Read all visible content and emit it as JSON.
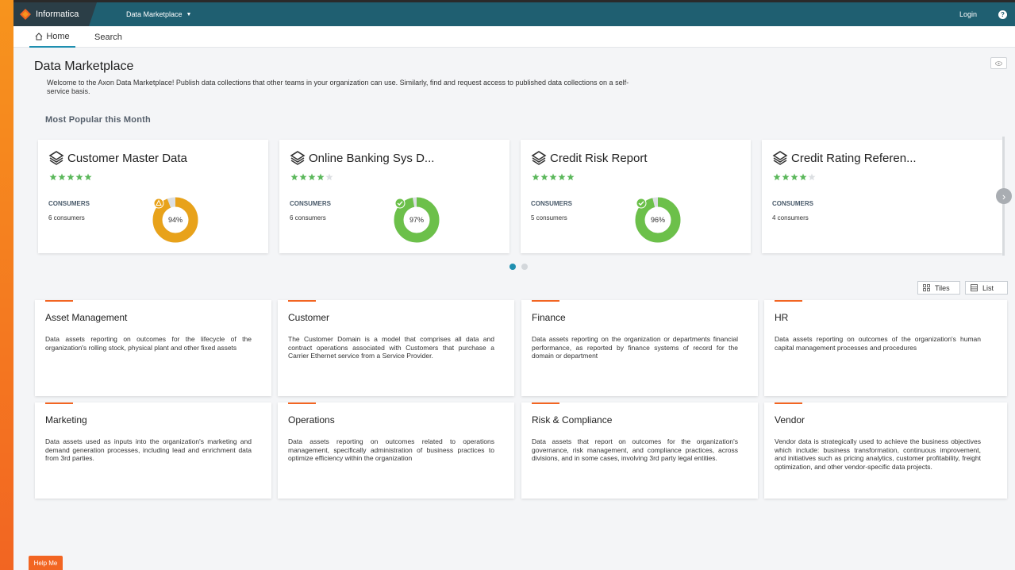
{
  "topbar": {
    "brand": "Informatica",
    "app_menu": "Data Marketplace",
    "login": "Login",
    "help": "?"
  },
  "nav": {
    "home": "Home",
    "search": "Search"
  },
  "page": {
    "title": "Data Marketplace",
    "welcome": "Welcome to the Axon Data Marketplace! Publish data collections that other teams in your organization can use. Similarly, find and request access to published data collections on a self-service basis.",
    "section_title": "Most Popular this Month"
  },
  "popular": [
    {
      "title": "Customer Master Data",
      "rating": 5,
      "consumers_label": "CONSUMERS",
      "consumers": "6 consumers",
      "percent": 94,
      "percent_label": "94%",
      "status": "warning",
      "color": "#e8a21a"
    },
    {
      "title": "Online Banking Sys D...",
      "rating": 4,
      "consumers_label": "CONSUMERS",
      "consumers": "6 consumers",
      "percent": 97,
      "percent_label": "97%",
      "status": "ok",
      "color": "#6cc04a"
    },
    {
      "title": "Credit Risk Report",
      "rating": 5,
      "consumers_label": "CONSUMERS",
      "consumers": "5 consumers",
      "percent": 96,
      "percent_label": "96%",
      "status": "ok",
      "color": "#6cc04a"
    },
    {
      "title": "Credit Rating Referen...",
      "rating": 4,
      "consumers_label": "CONSUMERS",
      "consumers": "4 consumers"
    }
  ],
  "carousel": {
    "pages": 2,
    "active": 0
  },
  "view_toggle": {
    "tiles": "Tiles",
    "list": "List"
  },
  "domains": [
    {
      "title": "Asset Management",
      "desc": "Data assets reporting on outcomes for the lifecycle of the organization's rolling stock, physical plant and other fixed assets"
    },
    {
      "title": "Customer",
      "desc": "The Customer Domain is a model that comprises all data and contract operations associated with Customers that purchase a Carrier Ethernet service from a Service Provider."
    },
    {
      "title": "Finance",
      "desc": "Data assets reporting on the organization or departments financial performance, as reported by finance systems of record for the domain or department"
    },
    {
      "title": "HR",
      "desc": "Data assets reporting on outcomes of the organization's human capital management processes and procedures"
    },
    {
      "title": "Marketing",
      "desc": "Data assets used as inputs into the organization's marketing and demand generation processes, including lead and enrichment data from 3rd parties."
    },
    {
      "title": "Operations",
      "desc": "Data assets reporting on outcomes related to operations management, specifically administration of business practices to optimize efficiency within the organization"
    },
    {
      "title": "Risk & Compliance",
      "desc": "Data assets that report on outcomes for the organization's governance, risk management, and compliance practices, across divisions, and in some cases, involving 3rd party legal entities."
    },
    {
      "title": "Vendor",
      "desc": "Vendor data is strategically used to achieve the business objectives which include: business transformation, continuous improvement, and initiatives such as pricing analytics, customer profitability, freight optimization, and other vendor-specific data projects."
    }
  ],
  "help_me": "Help Me",
  "colors": {
    "accent": "#f26522",
    "topbar": "#1f5f71",
    "star": "#5cb85c"
  }
}
